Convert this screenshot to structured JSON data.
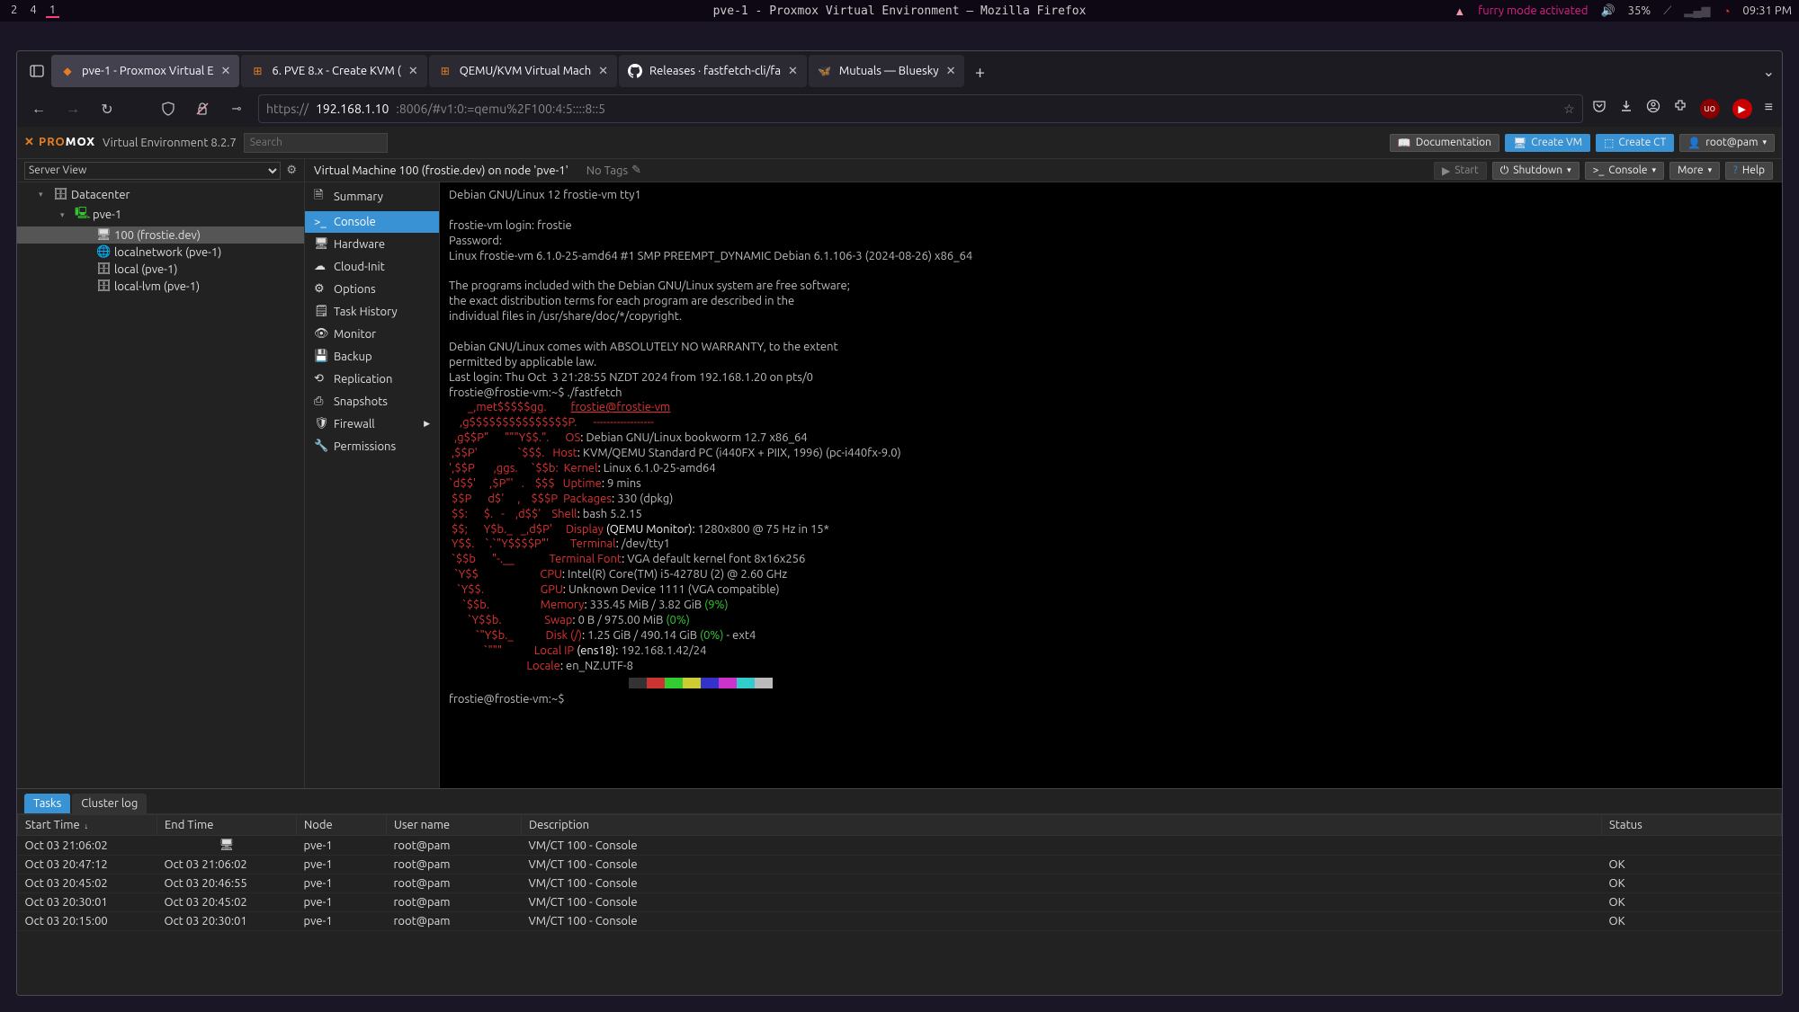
{
  "sysbar": {
    "workspaces": [
      "2",
      "4",
      "1"
    ],
    "active_workspace": 2,
    "window_title": "pve-1 - Proxmox Virtual Environment — Mozilla Firefox",
    "furry": "furry mode activated",
    "battery": "35%",
    "clock": "09:31 PM"
  },
  "firefox": {
    "tabs": [
      {
        "favicon": "proxmox",
        "label": "pve-1 - Proxmox Virtual E",
        "active": true
      },
      {
        "favicon": "proxmox-doc",
        "label": "6. PVE 8.x - Create KVM (",
        "active": false
      },
      {
        "favicon": "proxmox-doc",
        "label": "QEMU/KVM Virtual Mach",
        "active": false
      },
      {
        "favicon": "github",
        "label": "Releases · fastfetch-cli/fa",
        "active": false
      },
      {
        "favicon": "bluesky",
        "label": "Mutuals — Bluesky",
        "active": false
      }
    ],
    "url_prefix": "https://",
    "url_host": "192.168.1.10",
    "url_rest": ":8006/#v1:0:=qemu%2F100:4:5::::8::5"
  },
  "pve": {
    "logo_prefix": "PRO",
    "logo_suffix": "MOX",
    "version": "Virtual Environment 8.2.7",
    "search_placeholder": "Search",
    "hdr_buttons": {
      "documentation": "Documentation",
      "create_vm": "Create VM",
      "create_ct": "Create CT",
      "user": "root@pam"
    },
    "tree_view": "Server View",
    "tree": [
      {
        "depth": 1,
        "icon": "server",
        "label": "Datacenter",
        "expandable": true
      },
      {
        "depth": 2,
        "icon": "node",
        "label": "pve-1",
        "expandable": true,
        "green": true
      },
      {
        "depth": 3,
        "icon": "vm",
        "label": "100 (frostie.dev)",
        "sel": true
      },
      {
        "depth": 3,
        "icon": "net",
        "label": "localnetwork (pve-1)"
      },
      {
        "depth": 3,
        "icon": "disk",
        "label": "local (pve-1)"
      },
      {
        "depth": 3,
        "icon": "disk",
        "label": "local-lvm (pve-1)"
      }
    ],
    "crumb_title": "Virtual Machine 100 (frostie.dev) on node 'pve-1'",
    "crumb_tags": "No Tags",
    "actions": {
      "start": "Start",
      "shutdown": "Shutdown",
      "console": "Console",
      "more": "More",
      "help": "Help"
    },
    "submenu": [
      {
        "icon": "summary",
        "label": "Summary"
      },
      {
        "icon": "console",
        "label": "Console",
        "active": true
      },
      {
        "icon": "hardware",
        "label": "Hardware"
      },
      {
        "icon": "cloud",
        "label": "Cloud-Init"
      },
      {
        "icon": "options",
        "label": "Options"
      },
      {
        "icon": "history",
        "label": "Task History"
      },
      {
        "icon": "monitor",
        "label": "Monitor"
      },
      {
        "icon": "backup",
        "label": "Backup"
      },
      {
        "icon": "replication",
        "label": "Replication"
      },
      {
        "icon": "snapshot",
        "label": "Snapshots"
      },
      {
        "icon": "firewall",
        "label": "Firewall",
        "chev": true
      },
      {
        "icon": "perms",
        "label": "Permissions"
      }
    ],
    "console": {
      "pre_lines": [
        "Debian GNU/Linux 12 frostie-vm tty1",
        "",
        "frostie-vm login: frostie",
        "Password:",
        "Linux frostie-vm 6.1.0-25-amd64 #1 SMP PREEMPT_DYNAMIC Debian 6.1.106-3 (2024-08-26) x86_64",
        "",
        "The programs included with the Debian GNU/Linux system are free software;",
        "the exact distribution terms for each program are described in the",
        "individual files in /usr/share/doc/*/copyright.",
        "",
        "Debian GNU/Linux comes with ABSOLUTELY NO WARRANTY, to the extent",
        "permitted by applicable law.",
        "Last login: Thu Oct  3 21:28:55 NZDT 2024 from 192.168.1.20 on pts/0"
      ],
      "prompt1": "frostie@frostie-vm:~$ ./fastfetch",
      "ff_user": "frostie@frostie-vm",
      "ff_sep": "------------------",
      "ff": {
        "OS": "Debian GNU/Linux bookworm 12.7 x86_64",
        "Host": "KVM/QEMU Standard PC (i440FX + PIIX, 1996) (pc-i440fx-9.0)",
        "Kernel": "Linux 6.1.0-25-amd64",
        "Uptime": "9 mins",
        "Packages": "330 (dpkg)",
        "Shell": "bash 5.2.15",
        "Display": "1280x800 @ 75 Hz in 15*",
        "Display_sub": "(QEMU Monitor)",
        "Terminal": "/dev/tty1",
        "Terminal_Font": "VGA default kernel font 8x16x256",
        "CPU": "Intel(R) Core(TM) i5-4278U (2) @ 2.60 GHz",
        "GPU": "Unknown Device 1111 (VGA compatible)",
        "Memory": "335.45 MiB / 3.82 GiB (9%)",
        "Swap": "0 B / 975.00 MiB (0%)",
        "Disk": "1.25 GiB / 490.14 GiB (0%) - ext4",
        "LocalIP": "192.168.1.42/24",
        "LocalIP_sub": "(ens18)",
        "Locale": "en_NZ.UTF-8"
      },
      "prompt2": "frostie@frostie-vm:~$"
    },
    "task_tabs": {
      "tasks": "Tasks",
      "cluster": "Cluster log"
    },
    "task_headers": [
      "Start Time",
      "End Time",
      "Node",
      "User name",
      "Description",
      "Status"
    ],
    "tasks": [
      {
        "start": "Oct 03 21:06:02",
        "end": "",
        "node": "pve-1",
        "user": "root@pam",
        "desc": "VM/CT 100 - Console",
        "status": "",
        "running": true
      },
      {
        "start": "Oct 03 20:47:12",
        "end": "Oct 03 21:06:02",
        "node": "pve-1",
        "user": "root@pam",
        "desc": "VM/CT 100 - Console",
        "status": "OK"
      },
      {
        "start": "Oct 03 20:45:02",
        "end": "Oct 03 20:46:55",
        "node": "pve-1",
        "user": "root@pam",
        "desc": "VM/CT 100 - Console",
        "status": "OK"
      },
      {
        "start": "Oct 03 20:30:01",
        "end": "Oct 03 20:45:02",
        "node": "pve-1",
        "user": "root@pam",
        "desc": "VM/CT 100 - Console",
        "status": "OK"
      },
      {
        "start": "Oct 03 20:15:00",
        "end": "Oct 03 20:30:01",
        "node": "pve-1",
        "user": "root@pam",
        "desc": "VM/CT 100 - Console",
        "status": "OK"
      }
    ]
  }
}
